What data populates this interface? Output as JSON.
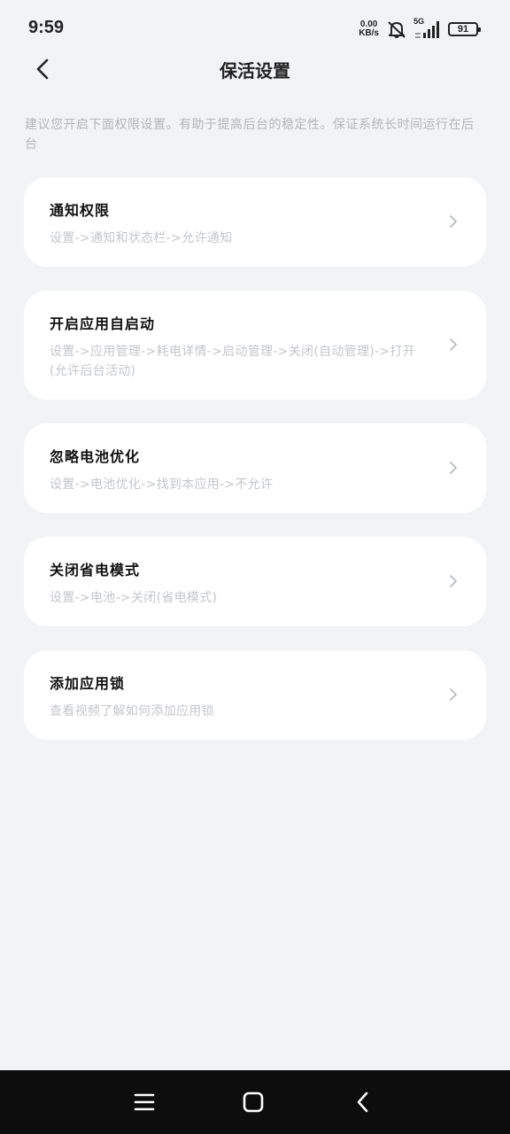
{
  "status": {
    "time": "9:59",
    "net_speed_value": "0.00",
    "net_speed_unit": "KB/s",
    "network_type": "5G",
    "battery_level": "91",
    "icons": [
      "mute-icon",
      "signal-icon",
      "battery-icon"
    ]
  },
  "header": {
    "title": "保活设置",
    "back_icon": "back-arrow-icon"
  },
  "description": "建议您开启下面权限设置。有助于提高后台的稳定性。保证系统长时间运行在后台",
  "items": [
    {
      "title": "通知权限",
      "subtitle": "设置->通知和状态栏->允许通知"
    },
    {
      "title": "开启应用自启动",
      "subtitle": "设置->应用管理->耗电详情->启动管理->关闭(自动管理)->打开(允许后台活动)"
    },
    {
      "title": "忽略电池优化",
      "subtitle": "设置->电池优化->找到本应用->不允许"
    },
    {
      "title": "关闭省电模式",
      "subtitle": "设置->电池->关闭(省电模式)"
    },
    {
      "title": "添加应用锁",
      "subtitle": "查看视频了解如何添加应用锁"
    }
  ],
  "navbar": {
    "icons": [
      "menu-icon",
      "home-icon",
      "back-icon"
    ]
  },
  "colors": {
    "background": "#f2f3f5",
    "card": "#ffffff",
    "title_text": "#111111",
    "hint_text": "#c4c6ca",
    "navbar": "#0d0d0d"
  }
}
